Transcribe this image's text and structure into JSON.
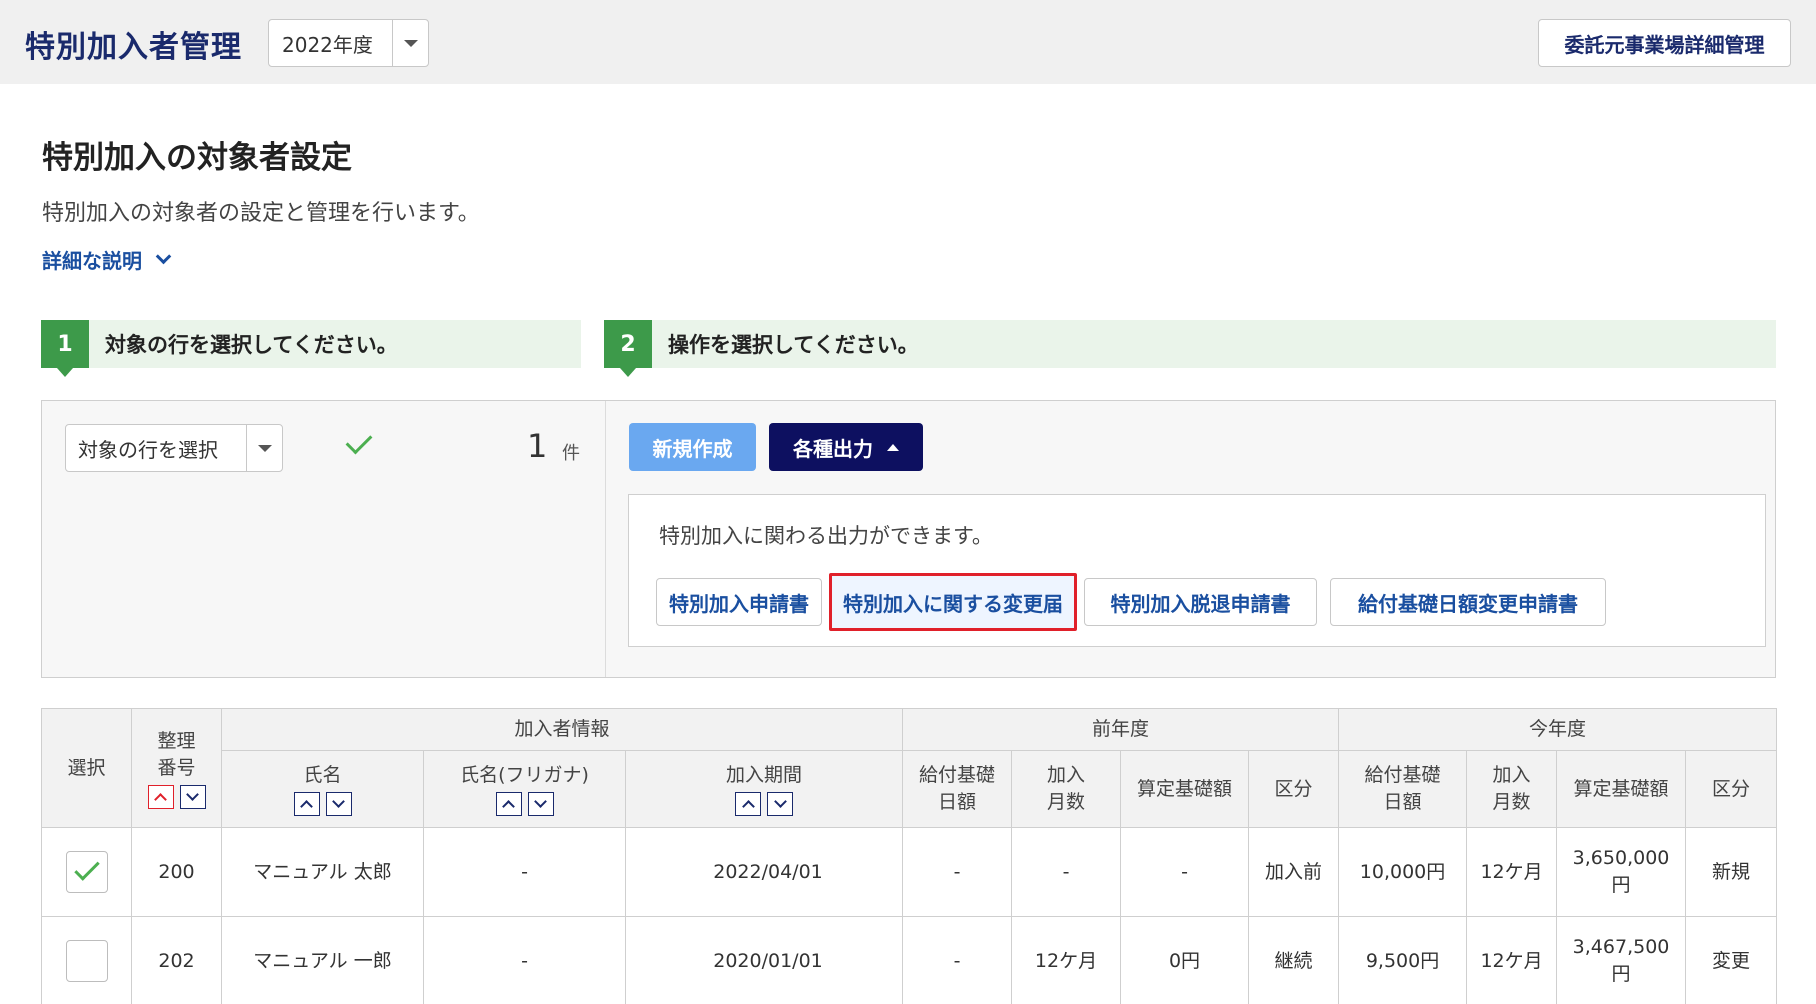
{
  "header": {
    "title": "特別加入者管理",
    "year": "2022年度",
    "detail_button": "委託元事業場詳細管理"
  },
  "intro": {
    "title": "特別加入の対象者設定",
    "description": "特別加入の対象者の設定と管理を行います。",
    "detail_link": "詳細な説明"
  },
  "steps": [
    {
      "num": "1",
      "text": "対象の行を選択してください。"
    },
    {
      "num": "2",
      "text": "操作を選択してください。"
    }
  ],
  "selection": {
    "select_label": "対象の行を選択",
    "count": "1",
    "count_unit": "件"
  },
  "actions": {
    "new_button": "新規作成",
    "output_button": "各種出力",
    "output_description": "特別加入に関わる出力ができます。",
    "output_buttons": [
      "特別加入申請書",
      "特別加入に関する変更届",
      "特別加入脱退申請書",
      "給付基礎日額変更申請書"
    ]
  },
  "table": {
    "headers": {
      "select": "選択",
      "number": "整理番号",
      "member_info": "加入者情報",
      "prev_year": "前年度",
      "this_year": "今年度",
      "name": "氏名",
      "kana": "氏名(フリガナ)",
      "period": "加入期間",
      "daily_base": "給付基礎日額",
      "months": "加入月数",
      "calc_base": "算定基礎額",
      "category": "区分"
    },
    "rows": [
      {
        "checked": true,
        "number": "200",
        "name": "マニュアル 太郎",
        "kana": "-",
        "period": "2022/04/01",
        "prev_daily": "-",
        "prev_months": "-",
        "prev_calc": "-",
        "prev_cat": "加入前",
        "cur_daily": "10,000円",
        "cur_months": "12ケ月",
        "cur_calc": "3,650,000円",
        "cur_cat": "新規"
      },
      {
        "checked": false,
        "number": "202",
        "name": "マニュアル 一郎",
        "kana": "-",
        "period": "2020/01/01",
        "prev_daily": "-",
        "prev_months": "12ケ月",
        "prev_calc": "0円",
        "prev_cat": "継続",
        "cur_daily": "9,500円",
        "cur_months": "12ケ月",
        "cur_calc": "3,467,500円",
        "cur_cat": "変更"
      }
    ]
  }
}
